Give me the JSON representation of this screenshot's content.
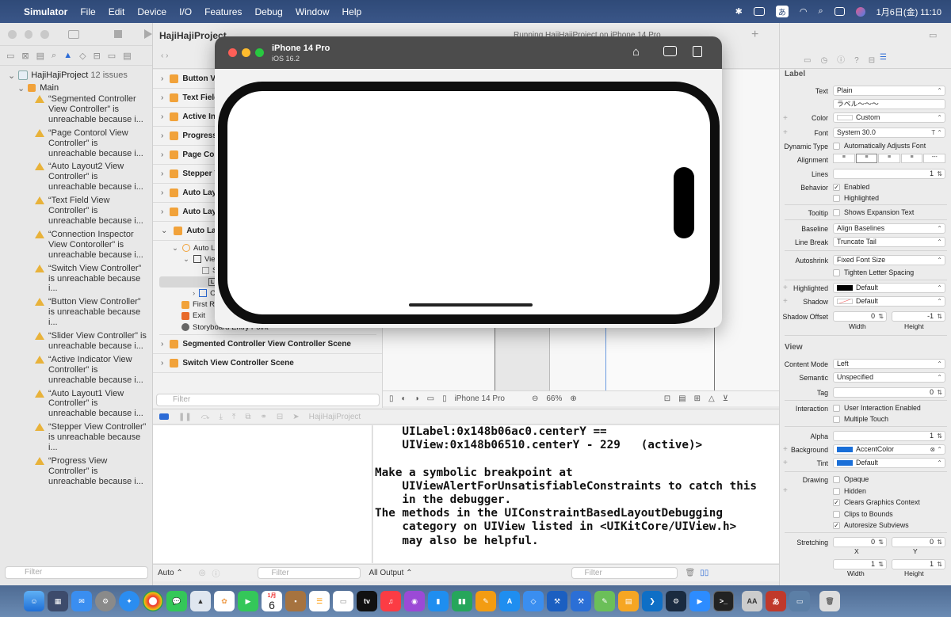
{
  "menubar": {
    "app_name": "Simulator",
    "menus": [
      "File",
      "Edit",
      "Device",
      "I/O",
      "Features",
      "Debug",
      "Window",
      "Help"
    ],
    "input_method": "あ",
    "datetime": "1月6日(金)  11:10"
  },
  "xcode": {
    "project_title": "HajiHajiProject",
    "running_status": "Running HajiHajiProject on iPhone 14 Pro",
    "issue_count_badge": "12",
    "jump_tail": "L"
  },
  "navigator": {
    "project": "HajiHajiProject",
    "issue_summary": "12 issues",
    "group": "Main",
    "issues": [
      "“Segmented Controller View Controller” is unreachable because i...",
      "“Page Contorol View Controller” is unreachable because i...",
      "“Auto Layout2 View Controller” is unreachable because i...",
      "“Text Field View Controller” is unreachable because i...",
      "“Connection Inspector View Contoroller” is unreachable because i...",
      "“Switch View Controller” is unreachable because i...",
      "“Button View Controller” is unreachable because i...",
      "“Slider View Controller” is unreachable because i...",
      "“Active Indicator View Controller” is unreachable because i...",
      "“Auto Layout1 View Controller” is unreachable because i...",
      "“Stepper View Controller” is unreachable because i...",
      "“Progress View Controller” is unreachable because i..."
    ],
    "filter_placeholder": "Filter"
  },
  "outline": {
    "scenes_top": [
      "Button View C",
      "Text Field",
      "Active Ind",
      "Progress V",
      "Page Cont",
      "Stepper V",
      "Auto Layo",
      "Auto Layo",
      "Auto Layo"
    ],
    "subitems": [
      "Auto La",
      "View",
      "S",
      "ラ",
      "Co",
      "First Respon",
      "Exit",
      "Storyboard Entry Point"
    ],
    "scenes_bottom": [
      "Segmented Controller View Controller Scene",
      "Switch View Controller Scene"
    ],
    "filter_placeholder": "Filter"
  },
  "canvas_bar": {
    "device": "iPhone 14 Pro",
    "zoom": "66%"
  },
  "debug": {
    "process": "HajiHajiProject",
    "console_text": "    UILabel:0x148b06ac0.centerY ==\n    UIView:0x148b06510.centerY - 229   (active)>\n\nMake a symbolic breakpoint at\n    UIViewAlertForUnsatisfiableConstraints to catch this\n    in the debugger.\nThe methods in the UIConstraintBasedLayoutDebugging\n    category on UIView listed in <UIKitCore/UIView.h>\n    may also be helpful.",
    "vars_mode": "Auto ⌃",
    "output_mode": "All Output ⌃",
    "filter_placeholder": "Filter"
  },
  "simulator": {
    "device_name": "iPhone 14 Pro",
    "os": "iOS 16.2"
  },
  "inspector": {
    "section_label": "Label",
    "text_label": "Text",
    "text_type": "Plain",
    "text_value": "ラベル〜〜〜",
    "color_label": "Color",
    "color_value": "Custom",
    "font_label": "Font",
    "font_value": "System 30.0",
    "dynamic_type_label": "Dynamic Type",
    "dynamic_type_value": "Automatically Adjusts Font",
    "alignment_label": "Alignment",
    "lines_label": "Lines",
    "lines_value": "1",
    "behavior_label": "Behavior",
    "enabled": "Enabled",
    "highlighted_chk": "Highlighted",
    "tooltip_label": "Tooltip",
    "tooltip_value": "Shows Expansion Text",
    "baseline_label": "Baseline",
    "baseline_value": "Align Baselines",
    "linebreak_label": "Line Break",
    "linebreak_value": "Truncate Tail",
    "autoshrink_label": "Autoshrink",
    "autoshrink_value": "Fixed Font Size",
    "tighten": "Tighten Letter Spacing",
    "highlighted_label": "Highlighted",
    "highlighted_value": "Default",
    "shadow_label": "Shadow",
    "shadow_value": "Default",
    "shadow_offset_label": "Shadow Offset",
    "shadow_w": "0",
    "shadow_h": "-1",
    "width": "Width",
    "height": "Height",
    "view_section": "View",
    "content_mode_label": "Content Mode",
    "content_mode_value": "Left",
    "semantic_label": "Semantic",
    "semantic_value": "Unspecified",
    "tag_label": "Tag",
    "tag_value": "0",
    "interaction_label": "Interaction",
    "user_interaction": "User Interaction Enabled",
    "multiple_touch": "Multiple Touch",
    "alpha_label": "Alpha",
    "alpha_value": "1",
    "background_label": "Background",
    "background_value": "AccentColor",
    "tint_label": "Tint",
    "tint_value": "Default",
    "drawing_label": "Drawing",
    "opaque": "Opaque",
    "hidden": "Hidden",
    "clears": "Clears Graphics Context",
    "clips": "Clips to Bounds",
    "autoresize": "Autoresize Subviews",
    "stretching_label": "Stretching",
    "stretch_x": "0",
    "stretch_y": "0",
    "x": "X",
    "y": "Y",
    "stretch_w": "1",
    "stretch_h": "1",
    "accent_color": "#1a6fd8"
  },
  "dock": {
    "calendar_month": "1月",
    "calendar_day": "6",
    "tv_label": "tv"
  }
}
